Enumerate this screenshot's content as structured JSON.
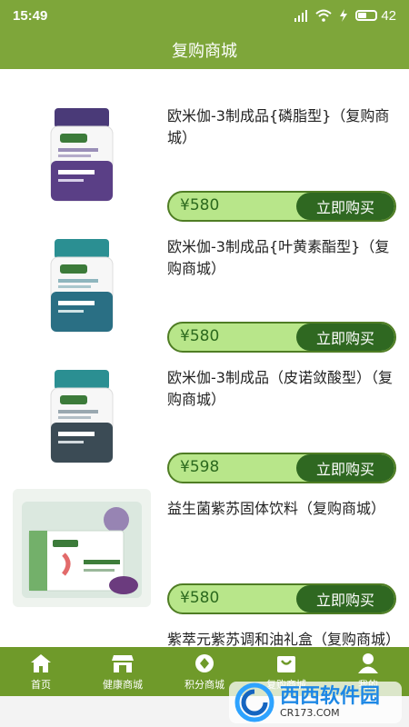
{
  "status": {
    "time": "15:49",
    "battery": "42",
    "battery_level": 0.42
  },
  "header": {
    "title": "复购商城"
  },
  "products": [
    {
      "title": "欧米伽-3制成品{磷脂型}（复购商城）",
      "price": "¥580",
      "buy_label": "立即购买",
      "image": "purple-cap-bottle"
    },
    {
      "title": "欧米伽-3制成品{叶黄素酯型}（复购商城）",
      "price": "¥580",
      "buy_label": "立即购买",
      "image": "teal-cap-bottle"
    },
    {
      "title": "欧米伽-3制成品（皮诺敛酸型）（复购商城）",
      "price": "¥598",
      "buy_label": "立即购买",
      "image": "teal-cap-bottle"
    },
    {
      "title": "益生菌紫苏固体饮料（复购商城）",
      "price": "¥580",
      "buy_label": "立即购买",
      "image": "green-box"
    },
    {
      "title": "紫萃元紫苏调和油礼盒（复购商城）",
      "price": "",
      "buy_label": "",
      "image": ""
    }
  ],
  "tabs": [
    {
      "label": "首页",
      "icon": "home-icon"
    },
    {
      "label": "健康商城",
      "icon": "store-icon"
    },
    {
      "label": "积分商城",
      "icon": "points-icon"
    },
    {
      "label": "复购商城",
      "icon": "shopping-bag-icon"
    },
    {
      "label": "我的",
      "icon": "user-icon"
    }
  ],
  "watermark": {
    "main": "西西软件园",
    "sub": "CR173.COM"
  },
  "colors": {
    "header": "#7ea63a",
    "tabbar": "#6f9a2a",
    "price_bg": "#b8e68a",
    "buy_bg": "#2f6821"
  }
}
